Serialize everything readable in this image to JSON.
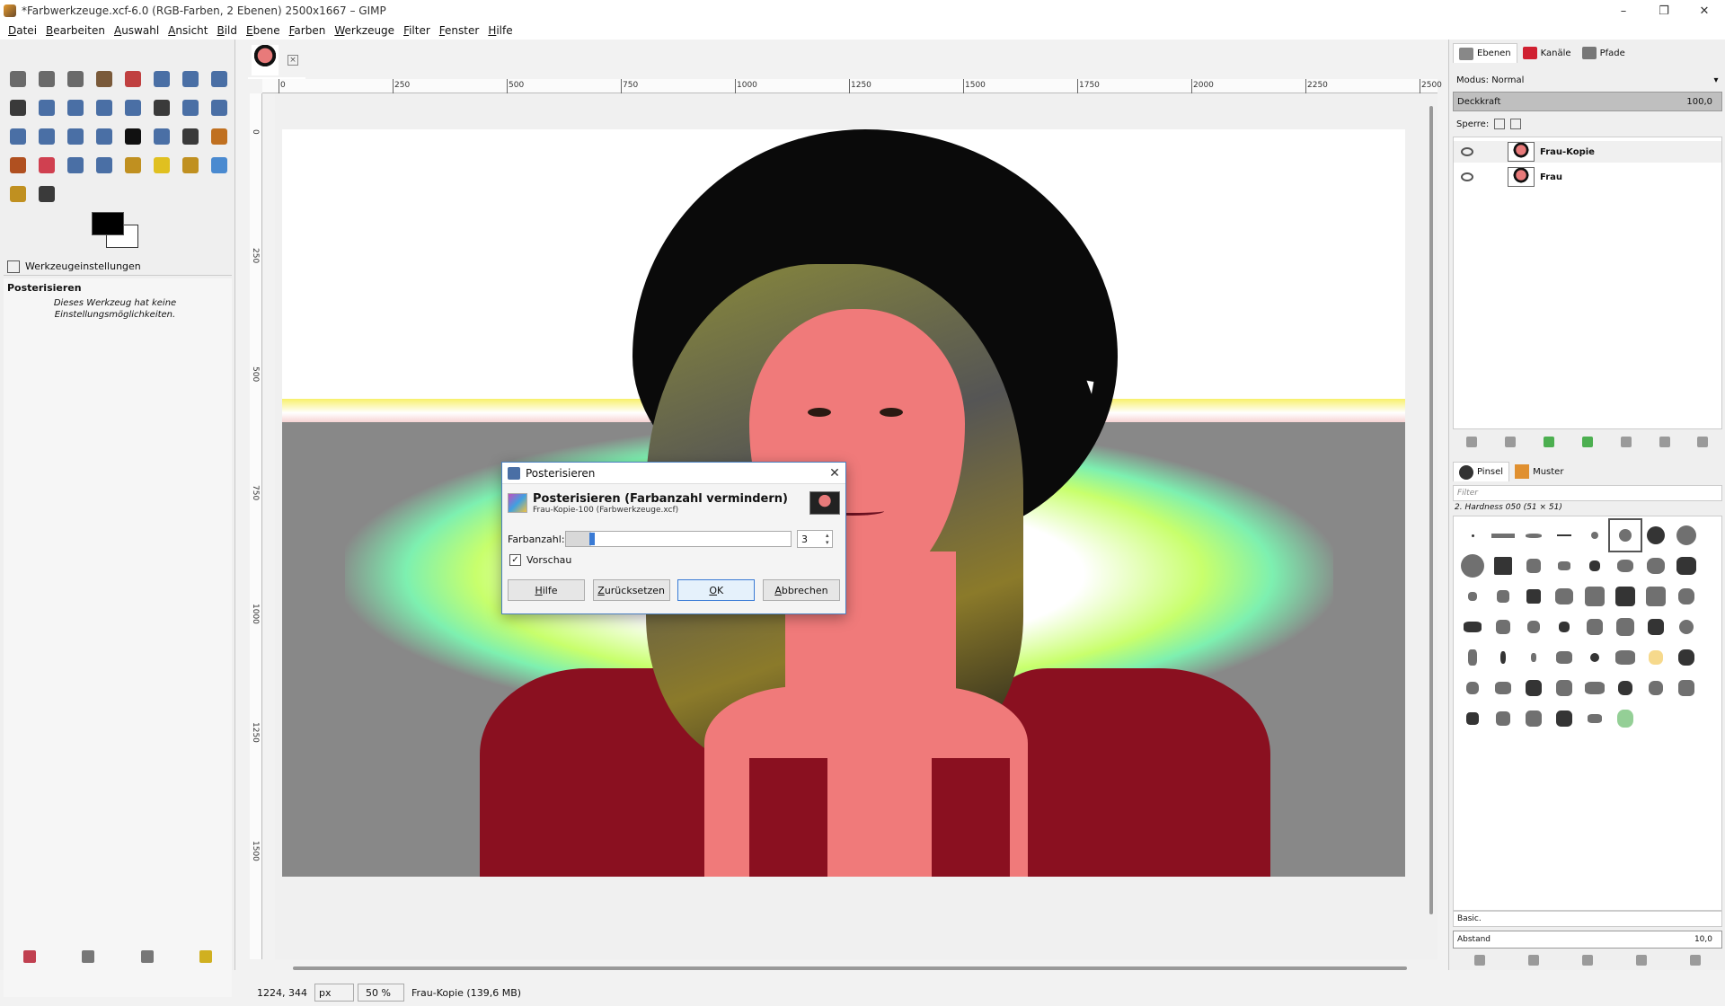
{
  "window": {
    "title": "*Farbwerkzeuge.xcf-6.0 (RGB-Farben, 2 Ebenen) 2500x1667 – GIMP",
    "minimize": "–",
    "maximize": "❐",
    "close": "✕"
  },
  "menu": [
    "Datei",
    "Bearbeiten",
    "Auswahl",
    "Ansicht",
    "Bild",
    "Ebene",
    "Farben",
    "Werkzeuge",
    "Filter",
    "Fenster",
    "Hilfe"
  ],
  "toolbox": {
    "tools": [
      {
        "icon": "rect-select-icon",
        "color": "#6a6a6a"
      },
      {
        "icon": "ellipse-select-icon",
        "color": "#6a6a6a"
      },
      {
        "icon": "lasso-icon",
        "color": "#6a6a6a"
      },
      {
        "icon": "fuzzy-select-icon",
        "color": "#7a5a3a"
      },
      {
        "icon": "color-select-icon",
        "color": "#c04040"
      },
      {
        "icon": "scissors-icon",
        "color": "#4a6fa5"
      },
      {
        "icon": "foreground-select-icon",
        "color": "#4a6fa5"
      },
      {
        "icon": "paths-icon",
        "color": "#4a6fa5"
      },
      {
        "icon": "color-picker-icon",
        "color": "#3a3a3a"
      },
      {
        "icon": "zoom-icon",
        "color": "#4a6fa5"
      },
      {
        "icon": "measure-icon",
        "color": "#4a6fa5"
      },
      {
        "icon": "move-icon",
        "color": "#4a6fa5"
      },
      {
        "icon": "align-icon",
        "color": "#4a6fa5"
      },
      {
        "icon": "crop-icon",
        "color": "#3a3a3a"
      },
      {
        "icon": "unified-transform-icon",
        "color": "#4a6fa5"
      },
      {
        "icon": "rotate-icon",
        "color": "#4a6fa5"
      },
      {
        "icon": "shear-icon",
        "color": "#4a6fa5"
      },
      {
        "icon": "perspective-icon",
        "color": "#4a6fa5"
      },
      {
        "icon": "flip-icon",
        "color": "#4a6fa5"
      },
      {
        "icon": "cage-icon",
        "color": "#4a6fa5"
      },
      {
        "icon": "text-tool-icon",
        "color": "#111111"
      },
      {
        "icon": "bucket-fill-icon",
        "color": "#4a6fa5"
      },
      {
        "icon": "gradient-icon",
        "color": "#3a3a3a"
      },
      {
        "icon": "pencil-icon",
        "color": "#c07020"
      },
      {
        "icon": "paintbrush-icon",
        "color": "#b05020"
      },
      {
        "icon": "eraser-icon",
        "color": "#d04050"
      },
      {
        "icon": "airbrush-icon",
        "color": "#4a6fa5"
      },
      {
        "icon": "ink-icon",
        "color": "#4a6fa5"
      },
      {
        "icon": "clone-icon",
        "color": "#c09020"
      },
      {
        "icon": "heal-icon",
        "color": "#e0c020"
      },
      {
        "icon": "perspective-clone-icon",
        "color": "#c09020"
      },
      {
        "icon": "blur-icon",
        "color": "#4a8ad0"
      },
      {
        "icon": "smudge-icon",
        "color": "#c09020"
      },
      {
        "icon": "dodge-burn-icon",
        "color": "#3a3a3a"
      }
    ],
    "options_tab": "Werkzeugeinstellungen",
    "options_heading": "Posterisieren",
    "options_note": "Dieses Werkzeug hat keine Einstellungsmöglichkeiten.",
    "bottom_icons": [
      {
        "icon": "save-options-icon",
        "color": "#c04050"
      },
      {
        "icon": "restore-options-icon",
        "color": "#777777"
      },
      {
        "icon": "delete-options-icon",
        "color": "#777777"
      },
      {
        "icon": "reset-options-icon",
        "color": "#d0b020"
      }
    ]
  },
  "canvas": {
    "ruler_h": [
      "0",
      "250",
      "500",
      "750",
      "1000",
      "1250",
      "1500",
      "1750",
      "2000",
      "2250",
      "2500"
    ],
    "ruler_v": [
      "0",
      "250",
      "500",
      "750",
      "1000",
      "1250",
      "1500"
    ],
    "status": {
      "coords": "1224, 344",
      "unit": "px",
      "zoom": "50 %",
      "layer_info": "Frau-Kopie (139,6 MB)"
    }
  },
  "dialog": {
    "title": "Posterisieren",
    "heading": "Posterisieren (Farbanzahl vermindern)",
    "subheading": "Frau-Kopie-100 (Farbwerkzeuge.xcf)",
    "label": "Farbanzahl:",
    "value": "3",
    "value_fraction": 0.04,
    "preview_label": "Vorschau",
    "preview_check": "✓",
    "buttons": {
      "help": "Hilfe",
      "reset": "Zurücksetzen",
      "ok": "OK",
      "cancel": "Abbrechen"
    }
  },
  "dock": {
    "tabs": [
      "Ebenen",
      "Kanäle",
      "Pfade"
    ],
    "mode": "Modus: Normal",
    "opacity_label": "Deckkraft",
    "opacity_value": "100,0",
    "lock_label": "Sperre:",
    "layers": [
      {
        "name": "Frau-Kopie",
        "selected": true
      },
      {
        "name": "Frau",
        "selected": false
      }
    ],
    "brush_tabs": [
      "Pinsel",
      "Muster"
    ],
    "filter_placeholder": "Filter",
    "brush_name": "2. Hardness 050 (51 × 51)",
    "brush_set": "Basic.",
    "spacing_label": "Abstand",
    "spacing_value": "10,0"
  },
  "colors": {
    "accent": "#3a7bd5",
    "dialog_border": "#4a7fc0"
  }
}
